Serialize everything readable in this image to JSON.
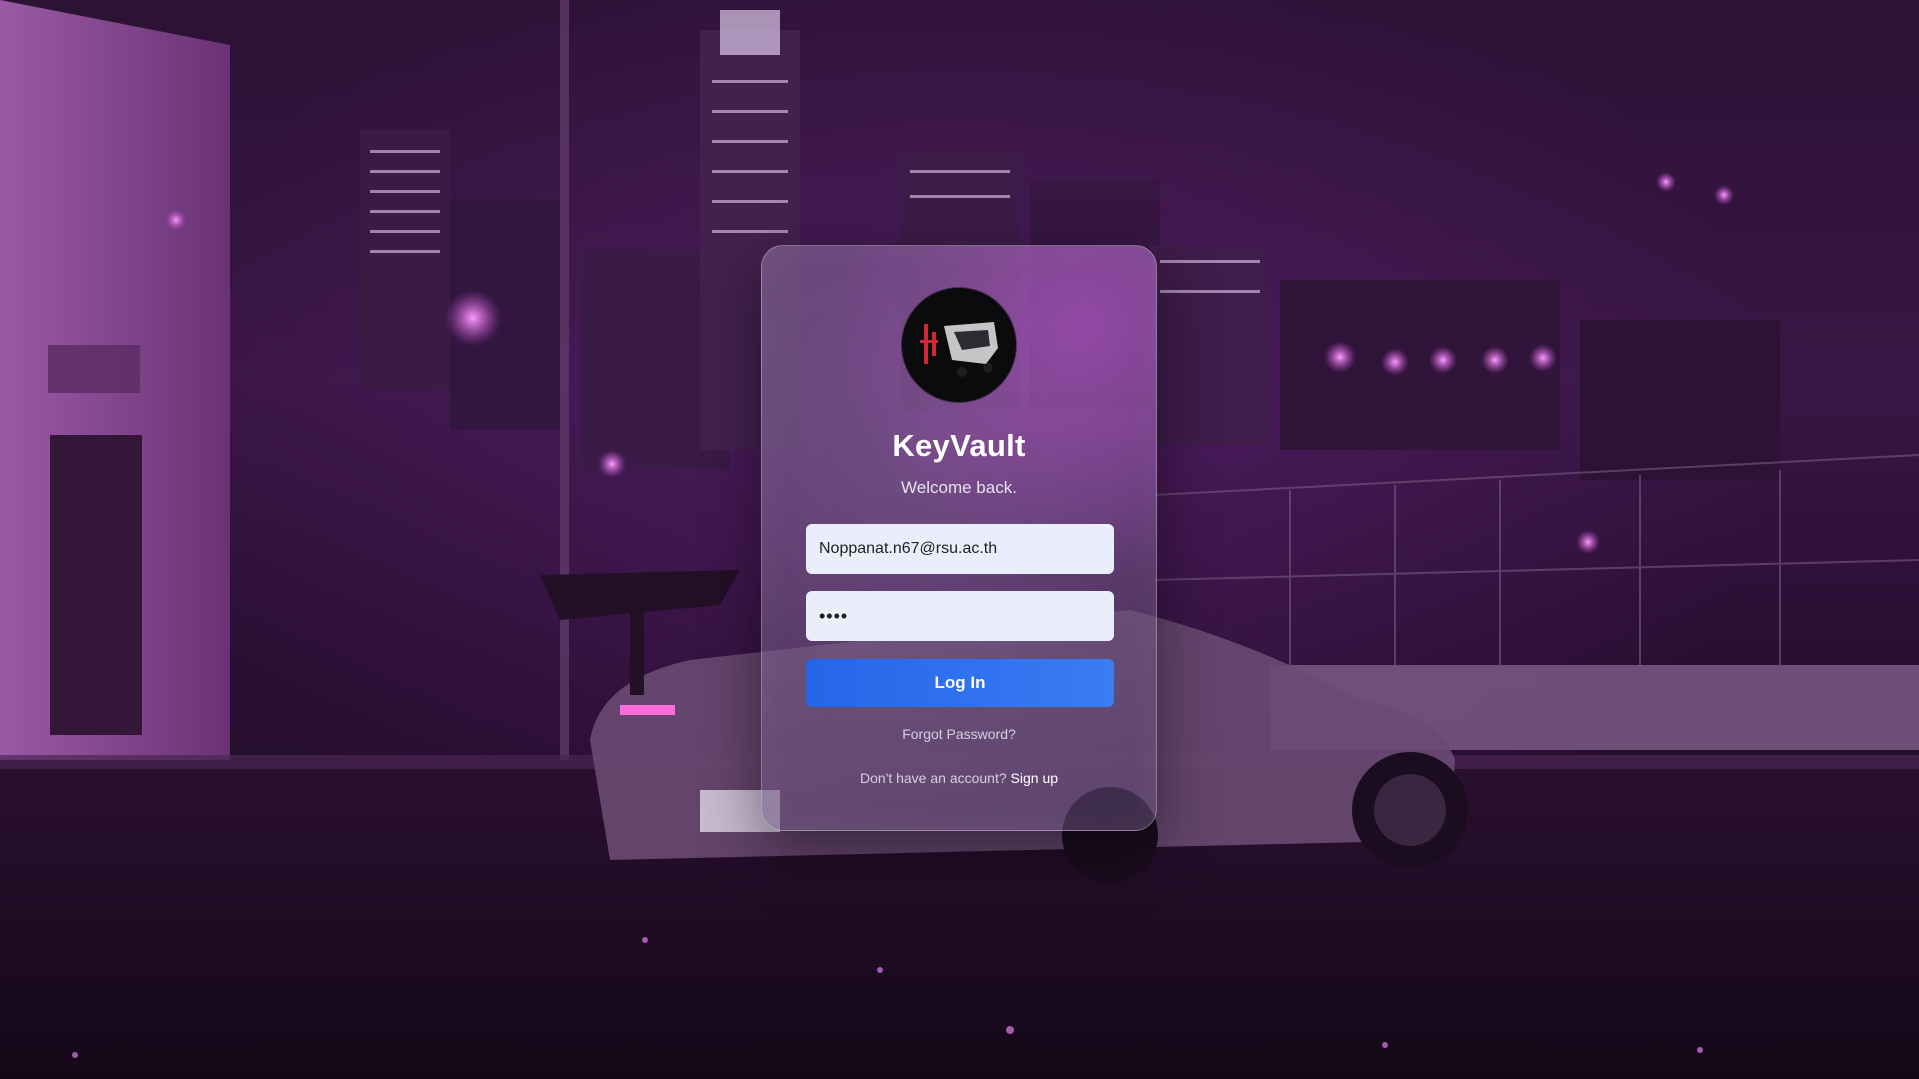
{
  "app": {
    "title": "KeyVault",
    "subtitle": "Welcome back."
  },
  "form": {
    "email_value": "Noppanat.n67@rsu.ac.th",
    "password_value": "••••",
    "login_label": "Log In",
    "forgot_label": "Forgot Password?",
    "signup_prompt": "Don't have an account?",
    "signup_label": "Sign up"
  },
  "colors": {
    "accent": "#2f6fee",
    "card_tint": "#8a6a9e",
    "background": "#2c1235"
  },
  "icons": {
    "avatar": "profile-avatar"
  }
}
